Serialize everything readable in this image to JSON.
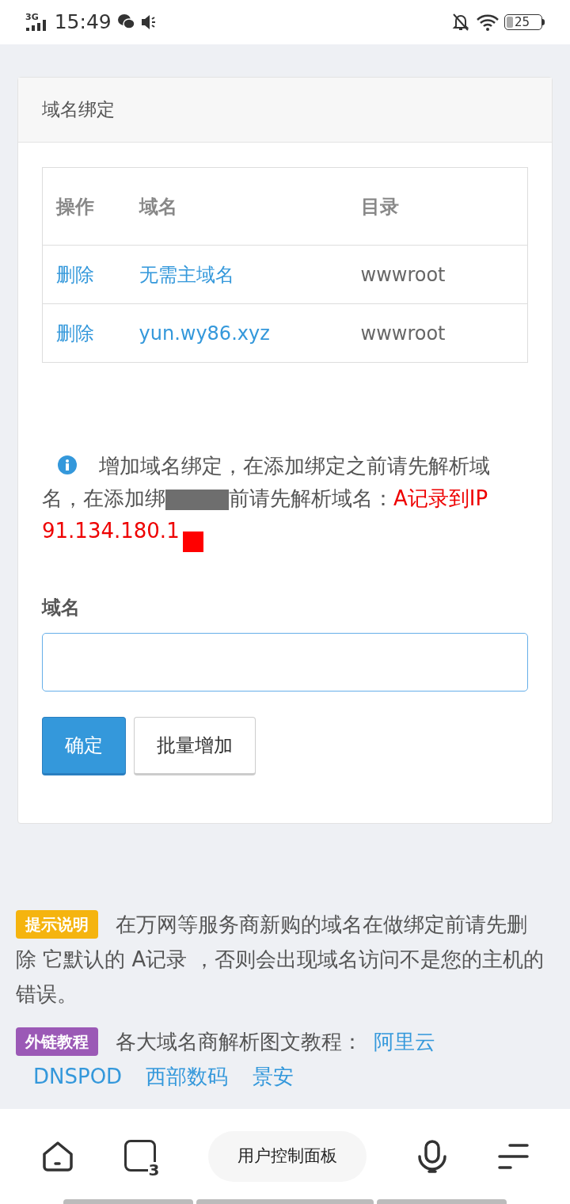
{
  "status_bar": {
    "network": "3G",
    "time": "15:49",
    "battery": "25"
  },
  "card": {
    "title": "域名绑定",
    "table": {
      "columns": [
        "操作",
        "域名",
        "目录"
      ],
      "rows": [
        {
          "action": "删除",
          "domain": "无需主域名",
          "directory": "wwwroot"
        },
        {
          "action": "删除",
          "domain": "yun.wy86.xyz",
          "directory": "wwwroot"
        }
      ]
    },
    "notice": {
      "text_before": "增加域名绑定，在添加绑定之前请先解析域名，在添加绑",
      "text_after": "前请先解析域名：",
      "highlight": "A记录到IP 91.134.180.1"
    },
    "field": {
      "label": "域名"
    },
    "buttons": [
      {
        "label": "确定",
        "kind": "primary"
      },
      {
        "label": "批量增加",
        "kind": "default"
      }
    ]
  },
  "tips": [
    {
      "badge": "提示说明",
      "color": "#f5b40f",
      "text": "在万网等服务商新购的域名在做绑定前请先删除 它默认的 A记录 ，否则会出现域名访问不是您的主机的错误。"
    },
    {
      "badge": "外链教程",
      "color": "#9b59b6",
      "text": "各大域名商解析图文教程：",
      "links": [
        "阿里云",
        "DNSPOD",
        "西部数码",
        "景安"
      ]
    }
  ],
  "bottom_nav": {
    "title": "用户控制面板",
    "tab_count": "3"
  }
}
